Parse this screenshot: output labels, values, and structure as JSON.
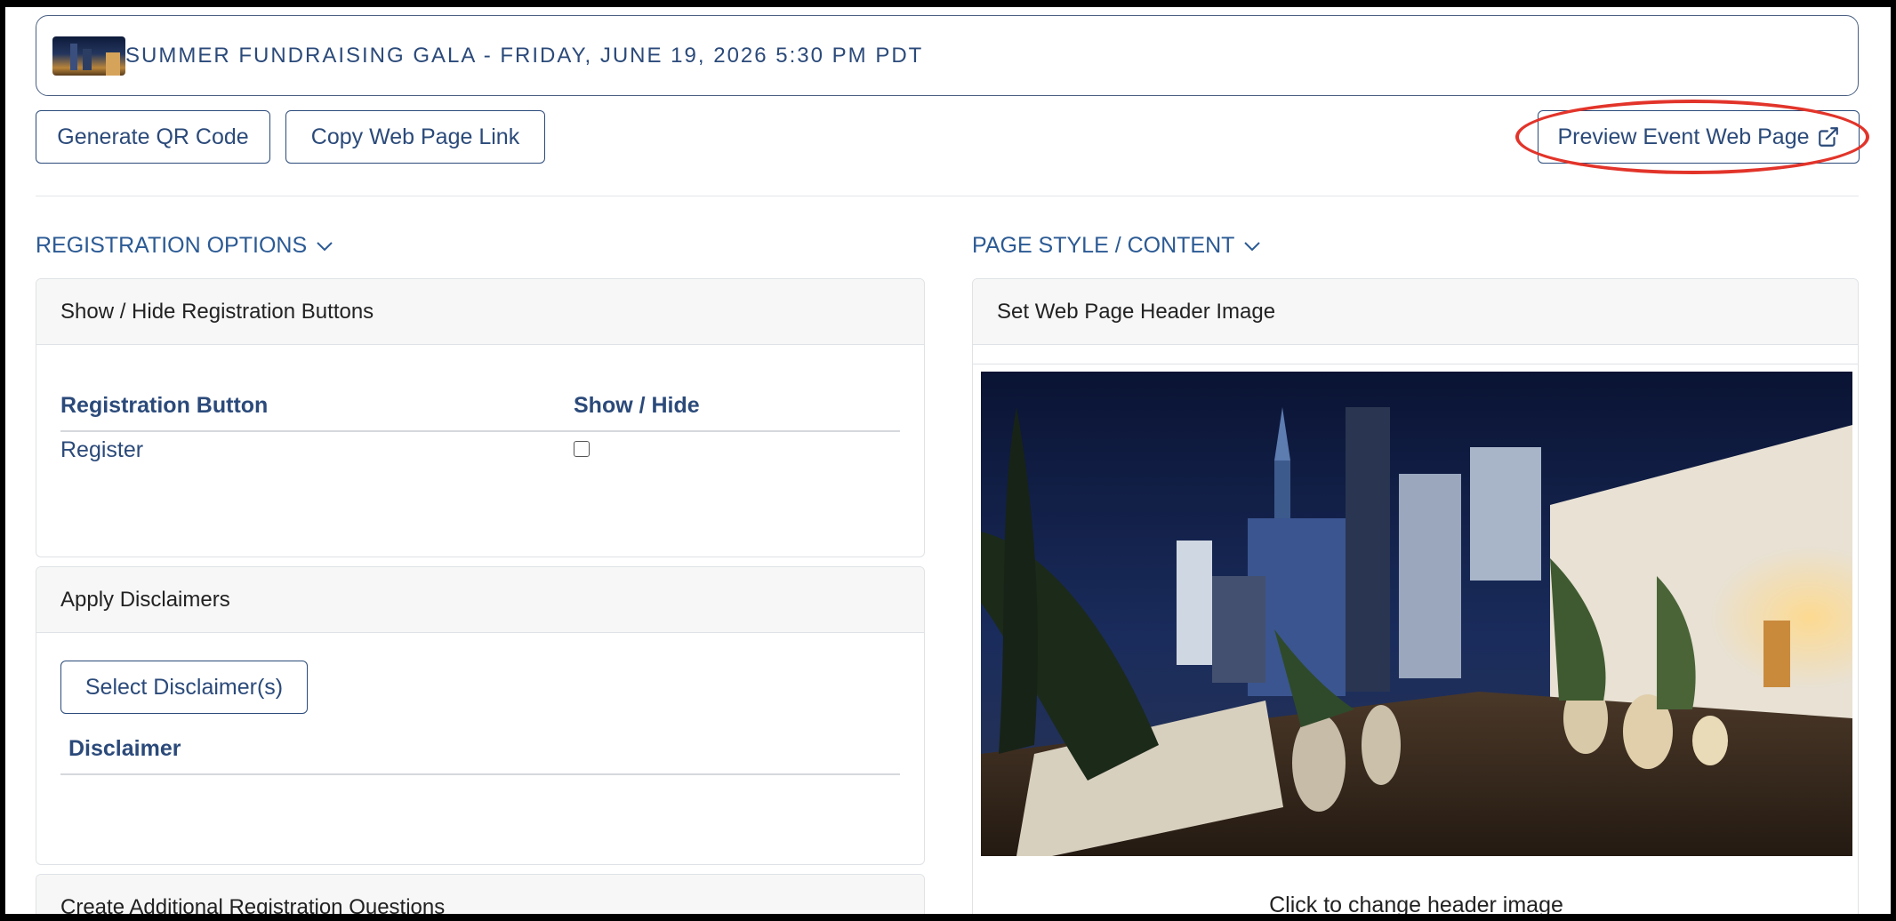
{
  "event": {
    "title": "SUMMER FUNDRAISING GALA - FRIDAY, JUNE 19, 2026 5:30 PM PDT"
  },
  "toolbar": {
    "qr_label": "Generate QR Code",
    "copy_label": "Copy Web Page Link",
    "preview_label": "Preview Event Web Page"
  },
  "sections": {
    "left_title": "REGISTRATION OPTIONS",
    "right_title": "PAGE STYLE / CONTENT"
  },
  "registration_buttons": {
    "card_title": "Show / Hide Registration Buttons",
    "columns": [
      "Registration Button",
      "Show / Hide"
    ],
    "rows": [
      {
        "label": "Register",
        "show": false
      }
    ]
  },
  "disclaimers": {
    "card_title": "Apply Disclaimers",
    "select_label": "Select Disclaimer(s)",
    "column": "Disclaimer"
  },
  "questions": {
    "card_title": "Create Additional Registration Questions"
  },
  "header_image": {
    "card_title": "Set Web Page Header Image",
    "caption": "Click to change header image"
  },
  "colors": {
    "accent": "#2b4a7a",
    "link": "#2b5a94",
    "highlight": "#e2342a"
  }
}
